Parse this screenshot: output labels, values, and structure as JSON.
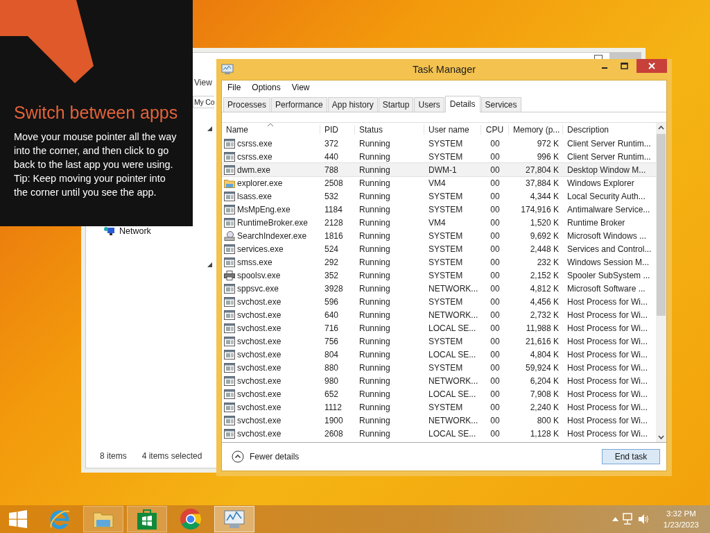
{
  "tip": {
    "title": "Switch between apps",
    "text": "Move your mouse pointer all the way into the corner, and then click to go back to the last app you were using.",
    "hint": "Tip: Keep moving your pointer into the corner until you see the app."
  },
  "explorer": {
    "menu_item": "View",
    "address": "My Co",
    "nav_item": "Network",
    "status_count": "8 items",
    "status_selected": "4 items selected"
  },
  "window": {
    "title": "Task Manager"
  },
  "menu": [
    "File",
    "Options",
    "View"
  ],
  "tabs": [
    {
      "label": "Processes",
      "selected": false
    },
    {
      "label": "Performance",
      "selected": false
    },
    {
      "label": "App history",
      "selected": false
    },
    {
      "label": "Startup",
      "selected": false
    },
    {
      "label": "Users",
      "selected": false
    },
    {
      "label": "Details",
      "selected": true
    },
    {
      "label": "Services",
      "selected": false
    }
  ],
  "table": {
    "columns": [
      "Name",
      "PID",
      "Status",
      "User name",
      "CPU",
      "Memory (p...",
      "Description"
    ],
    "rows": [
      {
        "kind": "app",
        "selected": false,
        "cells": [
          "csrss.exe",
          "372",
          "Running",
          "SYSTEM",
          "00",
          "972 K",
          "Client Server Runtim..."
        ]
      },
      {
        "kind": "app",
        "selected": false,
        "cells": [
          "csrss.exe",
          "440",
          "Running",
          "SYSTEM",
          "00",
          "996 K",
          "Client Server Runtim..."
        ]
      },
      {
        "kind": "app",
        "selected": true,
        "cells": [
          "dwm.exe",
          "788",
          "Running",
          "DWM-1",
          "00",
          "27,804 K",
          "Desktop Window M..."
        ]
      },
      {
        "kind": "folder",
        "selected": false,
        "cells": [
          "explorer.exe",
          "2508",
          "Running",
          "VM4",
          "00",
          "37,884 K",
          "Windows Explorer"
        ]
      },
      {
        "kind": "app",
        "selected": false,
        "cells": [
          "lsass.exe",
          "532",
          "Running",
          "SYSTEM",
          "00",
          "4,344 K",
          "Local Security Auth..."
        ]
      },
      {
        "kind": "app",
        "selected": false,
        "cells": [
          "MsMpEng.exe",
          "1184",
          "Running",
          "SYSTEM",
          "00",
          "174,916 K",
          "Antimalware Service..."
        ]
      },
      {
        "kind": "app",
        "selected": false,
        "cells": [
          "RuntimeBroker.exe",
          "2128",
          "Running",
          "VM4",
          "00",
          "1,520 K",
          "Runtime Broker"
        ]
      },
      {
        "kind": "search",
        "selected": false,
        "cells": [
          "SearchIndexer.exe",
          "1816",
          "Running",
          "SYSTEM",
          "00",
          "9,692 K",
          "Microsoft Windows ..."
        ]
      },
      {
        "kind": "app",
        "selected": false,
        "cells": [
          "services.exe",
          "524",
          "Running",
          "SYSTEM",
          "00",
          "2,448 K",
          "Services and Control..."
        ]
      },
      {
        "kind": "app",
        "selected": false,
        "cells": [
          "smss.exe",
          "292",
          "Running",
          "SYSTEM",
          "00",
          "232 K",
          "Windows Session M..."
        ]
      },
      {
        "kind": "printer",
        "selected": false,
        "cells": [
          "spoolsv.exe",
          "352",
          "Running",
          "SYSTEM",
          "00",
          "2,152 K",
          "Spooler SubSystem ..."
        ]
      },
      {
        "kind": "app",
        "selected": false,
        "cells": [
          "sppsvc.exe",
          "3928",
          "Running",
          "NETWORK...",
          "00",
          "4,812 K",
          "Microsoft Software ..."
        ]
      },
      {
        "kind": "app",
        "selected": false,
        "cells": [
          "svchost.exe",
          "596",
          "Running",
          "SYSTEM",
          "00",
          "4,456 K",
          "Host Process for Wi..."
        ]
      },
      {
        "kind": "app",
        "selected": false,
        "cells": [
          "svchost.exe",
          "640",
          "Running",
          "NETWORK...",
          "00",
          "2,732 K",
          "Host Process for Wi..."
        ]
      },
      {
        "kind": "app",
        "selected": false,
        "cells": [
          "svchost.exe",
          "716",
          "Running",
          "LOCAL SE...",
          "00",
          "11,988 K",
          "Host Process for Wi..."
        ]
      },
      {
        "kind": "app",
        "selected": false,
        "cells": [
          "svchost.exe",
          "756",
          "Running",
          "SYSTEM",
          "00",
          "21,616 K",
          "Host Process for Wi..."
        ]
      },
      {
        "kind": "app",
        "selected": false,
        "cells": [
          "svchost.exe",
          "804",
          "Running",
          "LOCAL SE...",
          "00",
          "4,804 K",
          "Host Process for Wi..."
        ]
      },
      {
        "kind": "app",
        "selected": false,
        "cells": [
          "svchost.exe",
          "880",
          "Running",
          "SYSTEM",
          "00",
          "59,924 K",
          "Host Process for Wi..."
        ]
      },
      {
        "kind": "app",
        "selected": false,
        "cells": [
          "svchost.exe",
          "980",
          "Running",
          "NETWORK...",
          "00",
          "6,204 K",
          "Host Process for Wi..."
        ]
      },
      {
        "kind": "app",
        "selected": false,
        "cells": [
          "svchost.exe",
          "652",
          "Running",
          "LOCAL SE...",
          "00",
          "7,908 K",
          "Host Process for Wi..."
        ]
      },
      {
        "kind": "app",
        "selected": false,
        "cells": [
          "svchost.exe",
          "1112",
          "Running",
          "SYSTEM",
          "00",
          "2,240 K",
          "Host Process for Wi..."
        ]
      },
      {
        "kind": "app",
        "selected": false,
        "cells": [
          "svchost.exe",
          "1900",
          "Running",
          "NETWORK...",
          "00",
          "800 K",
          "Host Process for Wi..."
        ]
      },
      {
        "kind": "app",
        "selected": false,
        "cells": [
          "svchost.exe",
          "2608",
          "Running",
          "LOCAL SE...",
          "00",
          "1,128 K",
          "Host Process for Wi..."
        ]
      }
    ]
  },
  "footer": {
    "toggle": "Fewer details",
    "button": "End task"
  },
  "taskbar": {
    "items": [
      {
        "kind": "ie",
        "running": false,
        "active": false
      },
      {
        "kind": "explorer",
        "running": true,
        "active": false
      },
      {
        "kind": "store",
        "running": true,
        "active": false
      },
      {
        "kind": "chrome",
        "running": false,
        "active": false
      },
      {
        "kind": "taskmgr",
        "running": true,
        "active": true
      }
    ],
    "time": "3:32 PM",
    "date": "1/23/2023"
  }
}
